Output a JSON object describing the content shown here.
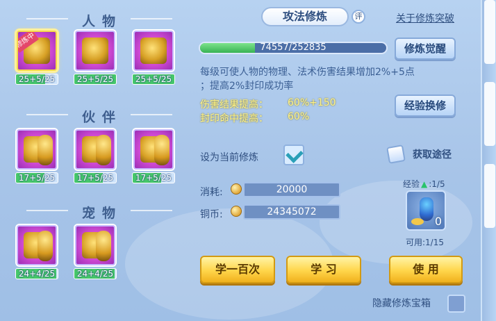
{
  "left": {
    "sections": [
      {
        "title": "人物",
        "items": [
          {
            "label": "25+5/25",
            "selected": true,
            "ribbon": "修炼中",
            "fill": 0.7
          },
          {
            "label": "25+5/25",
            "selected": false,
            "ribbon": "",
            "fill": 1.0
          },
          {
            "label": "25+5/25",
            "selected": false,
            "ribbon": "",
            "fill": 1.0
          }
        ]
      },
      {
        "title": "伙伴",
        "items": [
          {
            "label": "17+5/25",
            "selected": false,
            "ribbon": "",
            "fill": 0.68
          },
          {
            "label": "17+5/25",
            "selected": false,
            "ribbon": "",
            "fill": 0.68
          },
          {
            "label": "17+5/25",
            "selected": false,
            "ribbon": "",
            "fill": 0.68
          }
        ]
      },
      {
        "title": "宠物",
        "items": [
          {
            "label": "24+4/25",
            "selected": false,
            "ribbon": "",
            "fill": 0.96
          },
          {
            "label": "24+4/25",
            "selected": false,
            "ribbon": "",
            "fill": 0.96
          }
        ]
      }
    ]
  },
  "right": {
    "title": "攻法修炼",
    "rating": "评",
    "top_link": "关于修炼突破",
    "progress": {
      "text": "74557/252835",
      "fraction": 0.295
    },
    "btn_awaken": "修炼觉醒",
    "btn_exchange": "经验换修",
    "desc_line1": "每级可使人物的物理、法术伤害结果增加2%+5点",
    "desc_line2": "；提高2%封印成功率",
    "y1_label": "伤害结果提高：",
    "y1_value": "60%+150",
    "y2_label": "封印命中提高：",
    "y2_value": "60%",
    "set_current": "设为当前修炼",
    "get_path": "获取途径",
    "cost_label": "消耗:",
    "cost_value": "20000",
    "coin_label": "铜币:",
    "coin_value": "24345072",
    "exp_label": "经验",
    "exp_level": ":1/5",
    "exp_count": "0",
    "available": "可用:1/15",
    "btn_learn100": "学一百次",
    "btn_learn": "学 习",
    "btn_use": "使 用",
    "hide_chest": "隐藏修炼宝箱"
  },
  "colors": {
    "accent_blue": "#2f4f80",
    "gold": "#ffd54a",
    "green": "#45c76a",
    "yellow_text": "#fff48a"
  }
}
